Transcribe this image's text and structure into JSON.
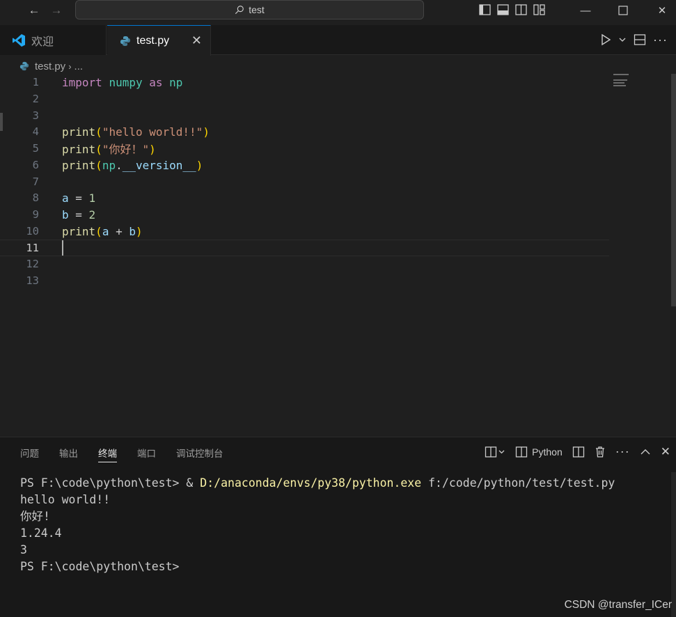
{
  "titlebar": {
    "search_text": "test"
  },
  "tabs": [
    {
      "label": "欢迎",
      "active": false
    },
    {
      "label": "test.py",
      "active": true
    }
  ],
  "breadcrumb": {
    "file": "test.py",
    "more": "..."
  },
  "editor": {
    "lines": [
      {
        "n": "1"
      },
      {
        "n": "2"
      },
      {
        "n": "3"
      },
      {
        "n": "4"
      },
      {
        "n": "5"
      },
      {
        "n": "6"
      },
      {
        "n": "7"
      },
      {
        "n": "8"
      },
      {
        "n": "9"
      },
      {
        "n": "10"
      },
      {
        "n": "11"
      },
      {
        "n": "12"
      },
      {
        "n": "13"
      }
    ],
    "tokens": {
      "l1_import": "import",
      "l1_numpy": "numpy",
      "l1_as": "as",
      "l1_np": "np",
      "l4_print": "print",
      "l4_str": "\"hello world!!\"",
      "l5_print": "print",
      "l5_str": "\"你好！\"",
      "l6_print": "print",
      "l6_np": "np",
      "l6_attr": "__version__",
      "l8_a": "a",
      "l8_eq": " = ",
      "l8_val": "1",
      "l9_b": "b",
      "l9_eq": " = ",
      "l9_val": "2",
      "l10_print": "print",
      "l10_a": "a",
      "l10_plus": " + ",
      "l10_b": "b"
    },
    "active_line": "11"
  },
  "panel": {
    "tabs": [
      "问题",
      "输出",
      "终端",
      "端口",
      "调试控制台"
    ],
    "active_tab": "终端",
    "terminal_name": "Python",
    "terminal": {
      "prompt1": "PS F:\\code\\python\\test> ",
      "cmd_amp": "& ",
      "cmd_exe": "D:/anaconda/envs/py38/python.exe",
      "cmd_arg": " f:/code/python/test/test.py",
      "out1": "hello world!!",
      "out2": "你好!",
      "out3": "1.24.4",
      "out4": "3",
      "prompt2": "PS F:\\code\\python\\test>"
    }
  },
  "watermark": "CSDN @transfer_ICer",
  "colors": {
    "keyword": "#c586c0",
    "module": "#4ec9b0",
    "function": "#dcdcaa",
    "string": "#ce9178",
    "variable": "#9cdcfe",
    "number": "#b5cea8",
    "accent": "#0078d4"
  }
}
